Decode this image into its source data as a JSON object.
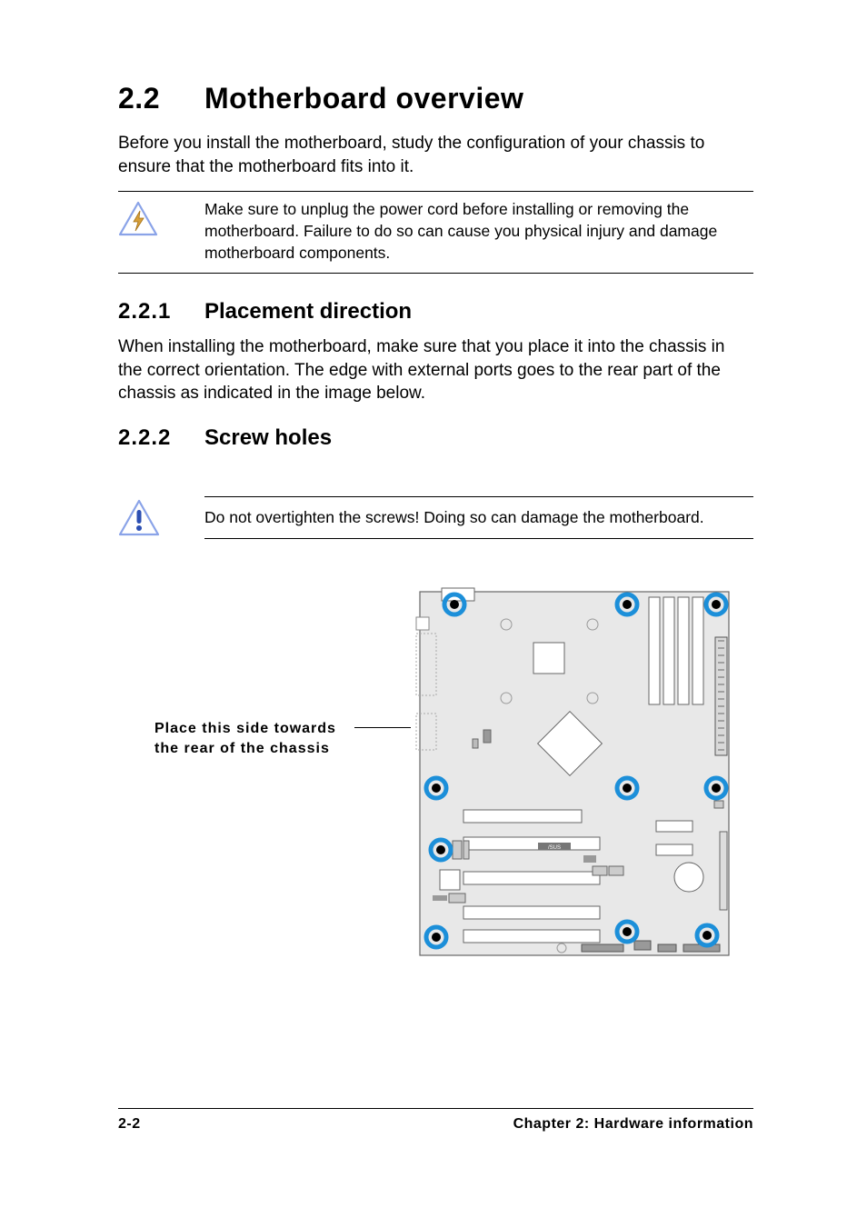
{
  "heading": {
    "number": "2.2",
    "title": "Motherboard overview"
  },
  "intro": "Before you install the motherboard, study the configuration of your chassis to ensure that the motherboard fits into it.",
  "warning1": "Make sure to unplug the power cord before installing or removing the motherboard. Failure to do so can cause you physical injury and damage motherboard components.",
  "sub1": {
    "number": "2.2.1",
    "title": "Placement direction"
  },
  "sub1_body": "When installing the motherboard, make sure that you place it into the chassis in the correct orientation. The edge with external ports goes to the rear part of the chassis as indicated in the image below.",
  "sub2": {
    "number": "2.2.2",
    "title": "Screw holes"
  },
  "caution": "Do not overtighten the screws! Doing so can damage the motherboard.",
  "diagram_label_line1": "Place this side towards",
  "diagram_label_line2": "the rear of the chassis",
  "footer": {
    "page": "2-2",
    "chapter": "Chapter 2: Hardware information"
  }
}
